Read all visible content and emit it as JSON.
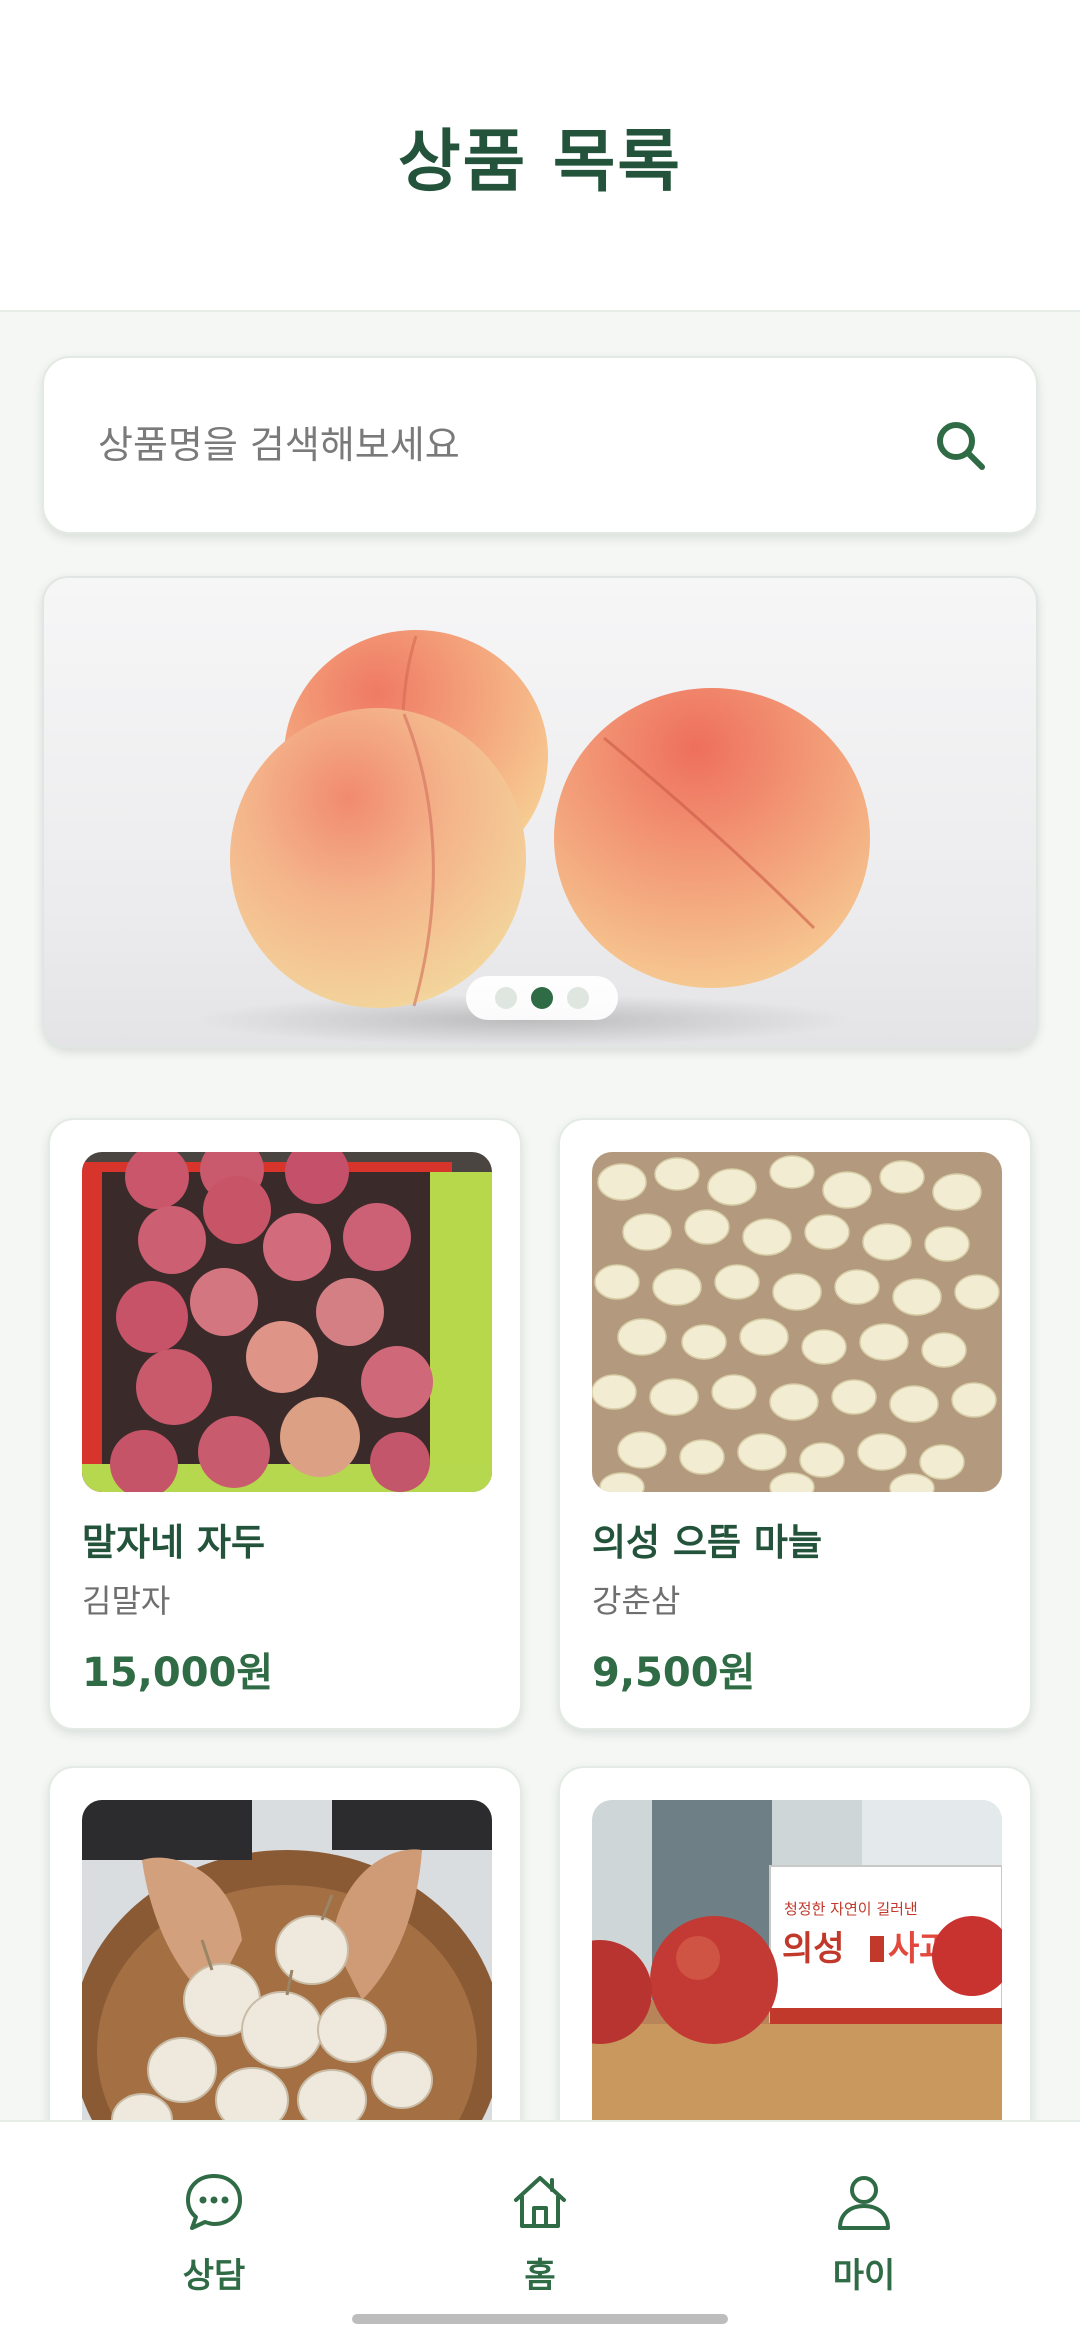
{
  "header": {
    "title": "상품 목록"
  },
  "search": {
    "placeholder": "상품명을 검색해보세요",
    "icon": "search-icon"
  },
  "banner": {
    "image": "peaches-photo",
    "pages": 3,
    "active_page": 2
  },
  "products": [
    {
      "name": "말자네 자두",
      "seller": "김말자",
      "price": "15,000원",
      "image": "plums-in-box"
    },
    {
      "name": "의성 으뜸 마늘",
      "seller": "강춘삼",
      "price": "9,500원",
      "image": "peeled-garlic"
    },
    {
      "image": "garlic-basket"
    },
    {
      "image": "apples-with-box",
      "box_tagline": "청정한 자연이 길러낸",
      "box_brand_prefix": "의성",
      "box_brand_suffix": "사과"
    }
  ],
  "nav": {
    "items": [
      {
        "label": "상담",
        "icon": "chat-icon"
      },
      {
        "label": "홈",
        "icon": "home-icon"
      },
      {
        "label": "마이",
        "icon": "person-icon"
      }
    ]
  },
  "colors": {
    "brand": "#23533a",
    "accent": "#2f6b45",
    "background": "#f5f7f5"
  }
}
